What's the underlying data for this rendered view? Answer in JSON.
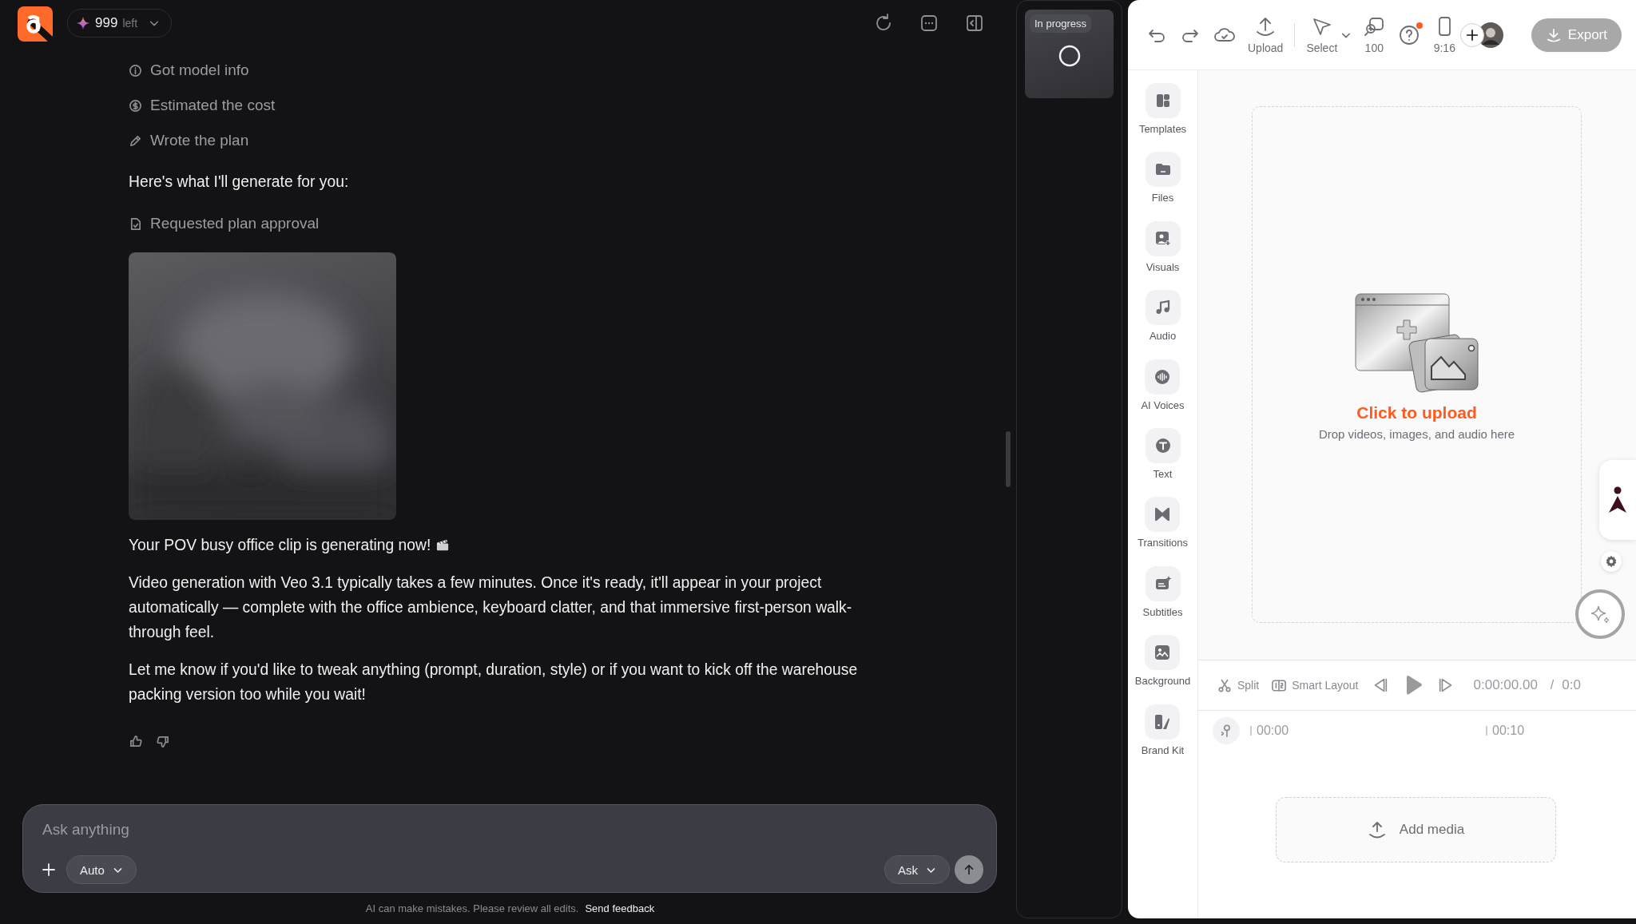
{
  "header": {
    "credits": {
      "count": "999",
      "suffix": "left"
    }
  },
  "thread": [
    {
      "kind": "step",
      "text": "Got model info"
    },
    {
      "kind": "step",
      "text": "Estimated the cost"
    },
    {
      "kind": "step",
      "text": "Wrote the plan"
    },
    {
      "kind": "text",
      "text": "Here's what I'll generate for you:"
    },
    {
      "kind": "step",
      "text": "Requested plan approval"
    },
    {
      "kind": "picture"
    },
    {
      "kind": "announce",
      "text": "Your POV busy office clip is generating now!"
    },
    {
      "kind": "text",
      "text": "Video generation with Veo 3.1 typically takes a few minutes. Once it's ready, it'll appear in your project automatically — complete with the office ambience, keyboard clatter, and that immersive first-person walk-through feel."
    },
    {
      "kind": "text",
      "text": "Let me know if you'd like to tweak anything (prompt, duration, style) or if you want to kick off the warehouse packing version too while you wait!"
    },
    {
      "kind": "feedback"
    }
  ],
  "composer": {
    "placeholder": "Ask anything",
    "mode": "Auto",
    "action": "Ask"
  },
  "footer": {
    "note": "AI can make mistakes. Please review all edits.",
    "link": "Send feedback"
  },
  "queue": [
    {
      "label": "In progress"
    }
  ],
  "toolbar": {
    "upload": "Upload",
    "select": "Select",
    "zoom": "100",
    "help_badge": true,
    "aspect": "9:16",
    "export": "Export"
  },
  "rail": [
    {
      "label": "Templates"
    },
    {
      "label": "Files"
    },
    {
      "label": "Visuals"
    },
    {
      "label": "Audio"
    },
    {
      "label": "AI Voices"
    },
    {
      "label": "Text"
    },
    {
      "label": "Transitions"
    },
    {
      "label": "Subtitles"
    },
    {
      "label": "Background"
    },
    {
      "label": "Brand Kit"
    }
  ],
  "upload": {
    "title": "Click to upload",
    "hint": "Drop videos, images, and audio here"
  },
  "timeline": {
    "split": "Split",
    "layout": "Smart Layout",
    "time": "0:00:00.00",
    "separator": "/",
    "duration": "0:0",
    "ticks": [
      "00:00",
      "00:10"
    ],
    "add_media": "Add media"
  }
}
